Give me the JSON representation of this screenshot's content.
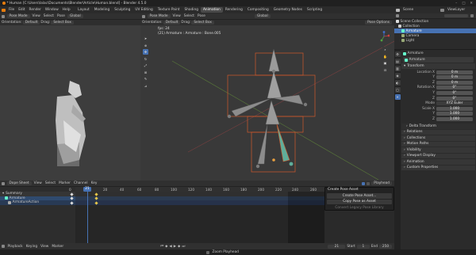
{
  "window": {
    "title": "* Human [C:\\Users\\lalac\\Documents\\Blender\\Article\\Human.blend] - Blender 4.5.0"
  },
  "menu": {
    "items": [
      "File",
      "Edit",
      "Render",
      "Window",
      "Help"
    ]
  },
  "workspaces": {
    "tabs": [
      "Layout",
      "Modeling",
      "Sculpting",
      "UV Editing",
      "Texture Paint",
      "Shading",
      "Animation",
      "Rendering",
      "Compositing",
      "Geometry Nodes",
      "Scripting"
    ],
    "active": "Animation"
  },
  "scene": {
    "name": "Scene",
    "view_layer": "ViewLayer"
  },
  "camera_view": {
    "mode": "Pose Mode",
    "view": "View",
    "select": "Select",
    "pose": "Pose",
    "transform": "Global",
    "orientation_label": "Orientation:",
    "orientation": "Default",
    "drag_label": "Drag:",
    "drag": "Select Box"
  },
  "viewport": {
    "mode": "Pose Mode",
    "view": "View",
    "select": "Select",
    "pose": "Pose",
    "transform": "Global",
    "orientation_label": "Orientation:",
    "orientation": "Default",
    "drag_label": "Drag:",
    "drag": "Select Box",
    "pose_options": "Pose Options",
    "info_fps": "fps: 24",
    "info_object": "(21) Armature : Armature : Bone.005"
  },
  "outliner": {
    "header": "Scene Collection",
    "rows": [
      {
        "label": "Collection",
        "level": 1
      },
      {
        "label": "Armature",
        "level": 2,
        "selected": true
      },
      {
        "label": "Camera",
        "level": 2
      },
      {
        "label": "Light",
        "level": 2
      }
    ]
  },
  "properties": {
    "object_name": "Armature",
    "bone_name": "Armature",
    "transform_title": "Transform",
    "location_label": "Location X",
    "location": [
      "0 m",
      "0 m",
      "0 m"
    ],
    "rotation_label": "Rotation X",
    "rotation": [
      "0°",
      "0°",
      "0°"
    ],
    "mode_label": "Mode",
    "mode": "XYZ Euler",
    "scale_label": "Scale X",
    "scale": [
      "1.000",
      "1.000",
      "1.000"
    ],
    "axis_y": "Y",
    "axis_z": "Z",
    "delta_transform": "Delta Transform",
    "sections": [
      "Relations",
      "Collections",
      "Motion Paths",
      "Visibility",
      "Viewport Display",
      "Animation",
      "Custom Properties"
    ]
  },
  "dopesheet": {
    "editor": "Dope Sheet",
    "menus": [
      "View",
      "Select",
      "Marker",
      "Channel",
      "Key"
    ],
    "action_editor": "Playhead",
    "current_frame": "21",
    "ruler": [
      "0",
      "20",
      "40",
      "60",
      "80",
      "100",
      "120",
      "140",
      "160",
      "180",
      "200",
      "220",
      "240",
      "260"
    ],
    "channels": [
      {
        "label": "Summary",
        "level": 0
      },
      {
        "label": "Armature",
        "level": 1
      },
      {
        "label": "ArmatureAction",
        "level": 2
      }
    ]
  },
  "context_menu": {
    "title": "Create Pose Asset",
    "items": [
      "Create Pose Asset...",
      "Copy Pose as Asset",
      "Convert Legacy Pose Library"
    ]
  },
  "timeline": {
    "playback": "Playback",
    "keying": "Keying",
    "view": "View",
    "marker": "Marker",
    "frame": "21",
    "start_label": "Start",
    "start": "1",
    "end_label": "End",
    "end": "250"
  },
  "status": {
    "center": "Zoom Playhead"
  },
  "colors": {
    "accent": "#4772b3",
    "bone_active": "#e06030",
    "keyframe": "#e8c84a",
    "header": "#303030"
  }
}
